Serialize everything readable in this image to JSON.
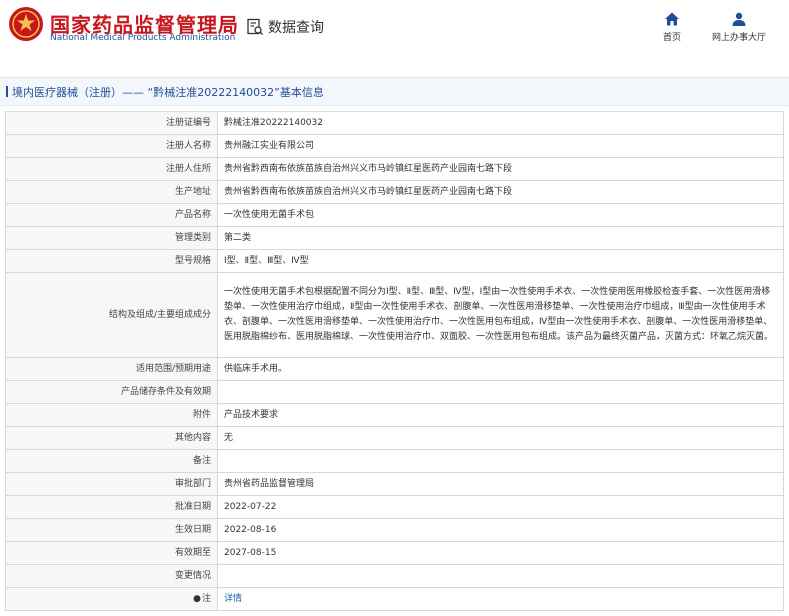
{
  "header": {
    "logo_cn": "国家药品监督管理局",
    "logo_en": "National Medical Products Administration",
    "data_query": "数据查询",
    "nav": [
      {
        "label": "首页",
        "icon": "home-icon"
      },
      {
        "label": "网上办事大厅",
        "icon": "user-icon"
      }
    ],
    "brand_color": "#c8161d",
    "accent_color": "#1f4e9c"
  },
  "breadcrumb": "境内医疗器械（注册）—— “黔械注准20222140032”基本信息",
  "rows": [
    {
      "label": "注册证编号",
      "value": "黔械注准20222140032"
    },
    {
      "label": "注册人名称",
      "value": "贵州融江实业有限公司"
    },
    {
      "label": "注册人住所",
      "value": "贵州省黔西南布依族苗族自治州兴义市马岭镇红星医药产业园南七路下段"
    },
    {
      "label": "生产地址",
      "value": "贵州省黔西南布依族苗族自治州兴义市马岭镇红星医药产业园南七路下段"
    },
    {
      "label": "产品名称",
      "value": "一次性使用无菌手术包"
    },
    {
      "label": "管理类别",
      "value": "第二类"
    },
    {
      "label": "型号规格",
      "value": "Ⅰ型、Ⅱ型、Ⅲ型、Ⅳ型"
    },
    {
      "label": "结构及组成/主要组成成分",
      "value": "一次性使用无菌手术包根据配置不同分为Ⅰ型、Ⅱ型、Ⅲ型、Ⅳ型，Ⅰ型由一次性使用手术衣、一次性使用医用橡胶检查手套、一次性医用滑移垫单、一次性使用治疗巾组成，Ⅱ型由一次性使用手术衣、剖腹单、一次性医用滑移垫单、一次性使用治疗巾组成，Ⅲ型由一次性使用手术衣、剖腹单、一次性医用滑移垫单、一次性使用治疗巾、一次性医用包布组成，Ⅳ型由一次性使用手术衣、剖腹单、一次性医用滑移垫单、医用脱脂棉纱布、医用脱脂棉球、一次性使用治疗巾、双面胶、一次性医用包布组成。该产品为最终灭菌产品，灭菌方式：环氧乙烷灭菌。",
      "tall": true
    },
    {
      "label": "适用范围/预期用途",
      "value": "供临床手术用。"
    },
    {
      "label": "产品储存条件及有效期",
      "value": ""
    },
    {
      "label": "附件",
      "value": "产品技术要求"
    },
    {
      "label": "其他内容",
      "value": "无"
    },
    {
      "label": "备注",
      "value": ""
    },
    {
      "label": "审批部门",
      "value": "贵州省药品监督管理局"
    },
    {
      "label": "批准日期",
      "value": "2022-07-22"
    },
    {
      "label": "生效日期",
      "value": "2022-08-16"
    },
    {
      "label": "有效期至",
      "value": "2027-08-15"
    },
    {
      "label": "变更情况",
      "value": ""
    }
  ],
  "footnote": {
    "dot": "●",
    "label": "注",
    "link": "详情"
  }
}
